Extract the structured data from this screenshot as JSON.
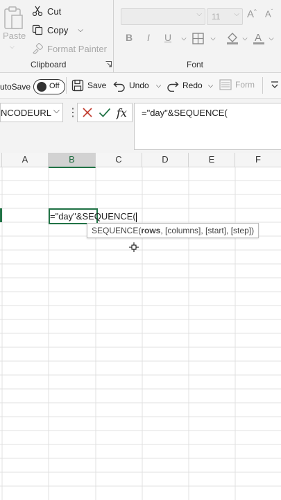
{
  "ribbon": {
    "clipboard": {
      "paste_label": "Paste",
      "cut_label": "Cut",
      "copy_label": "Copy",
      "format_painter_label": "Format Painter",
      "group_label": "Clipboard"
    },
    "font": {
      "font_name": "",
      "font_size": "11",
      "group_label": "Font",
      "bold": "B",
      "italic": "I",
      "underline": "U"
    }
  },
  "qat": {
    "autosave_label": "utoSave",
    "autosave_state": "Off",
    "save_label": "Save",
    "undo_label": "Undo",
    "redo_label": "Redo",
    "form_label": "Form"
  },
  "formula_bar": {
    "name_box": "NCODEURL",
    "fx_label": "fx",
    "formula": "=\"day\"&SEQUENCE("
  },
  "grid": {
    "columns": [
      "A",
      "B",
      "C",
      "D",
      "E",
      "F"
    ],
    "active_column": "B",
    "active_cell_text": "=\"day\"&SEQUENCE(",
    "tooltip": {
      "function_name": "SEQUENCE(",
      "current_arg": "rows",
      "rest": ", [columns], [start], [step])"
    }
  },
  "colors": {
    "accent": "#217346",
    "ribbon_bg": "#f3f3f3"
  }
}
